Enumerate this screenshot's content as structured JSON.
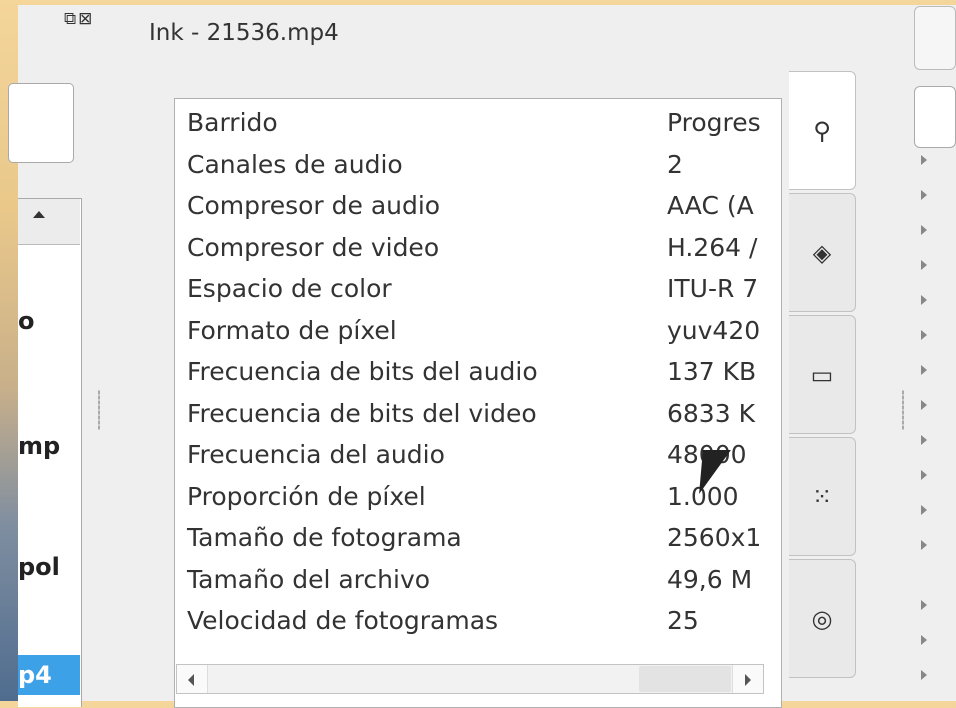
{
  "window": {
    "title": "Ink - 21536.mp4",
    "control_icons": [
      "restore-icon",
      "close-icon"
    ]
  },
  "left_panel": {
    "rows": [
      "o",
      "mp",
      "pol",
      "p4"
    ]
  },
  "info": {
    "rows": [
      {
        "key": "Barrido",
        "value": "Progres"
      },
      {
        "key": "Canales de audio",
        "value": "2"
      },
      {
        "key": "Compresor de audio",
        "value": "AAC (A"
      },
      {
        "key": "Compresor de video",
        "value": "H.264 /"
      },
      {
        "key": "Espacio de color",
        "value": "ITU-R 7"
      },
      {
        "key": "Formato de píxel",
        "value": "yuv420"
      },
      {
        "key": "Frecuencia de bits del audio",
        "value": "137 KB"
      },
      {
        "key": "Frecuencia de bits del video",
        "value": "6833 K"
      },
      {
        "key": "Frecuencia del audio",
        "value": "48000"
      },
      {
        "key": "Proporción de píxel",
        "value": "1.000"
      },
      {
        "key": "Tamaño de fotograma",
        "value": "2560x1"
      },
      {
        "key": "Tamaño del archivo",
        "value": "49,6 M"
      },
      {
        "key": "Velocidad de fotogramas",
        "value": "25"
      }
    ]
  },
  "tabs": [
    {
      "icon": "search-icon",
      "glyph": "⚲",
      "active": true
    },
    {
      "icon": "tag-icon",
      "glyph": "◈",
      "active": false
    },
    {
      "icon": "rectangle-icon",
      "glyph": "▭",
      "active": false
    },
    {
      "icon": "grid-dots-icon",
      "glyph": "⁙",
      "active": false
    },
    {
      "icon": "swirl-icon",
      "glyph": "◎",
      "active": false
    }
  ]
}
